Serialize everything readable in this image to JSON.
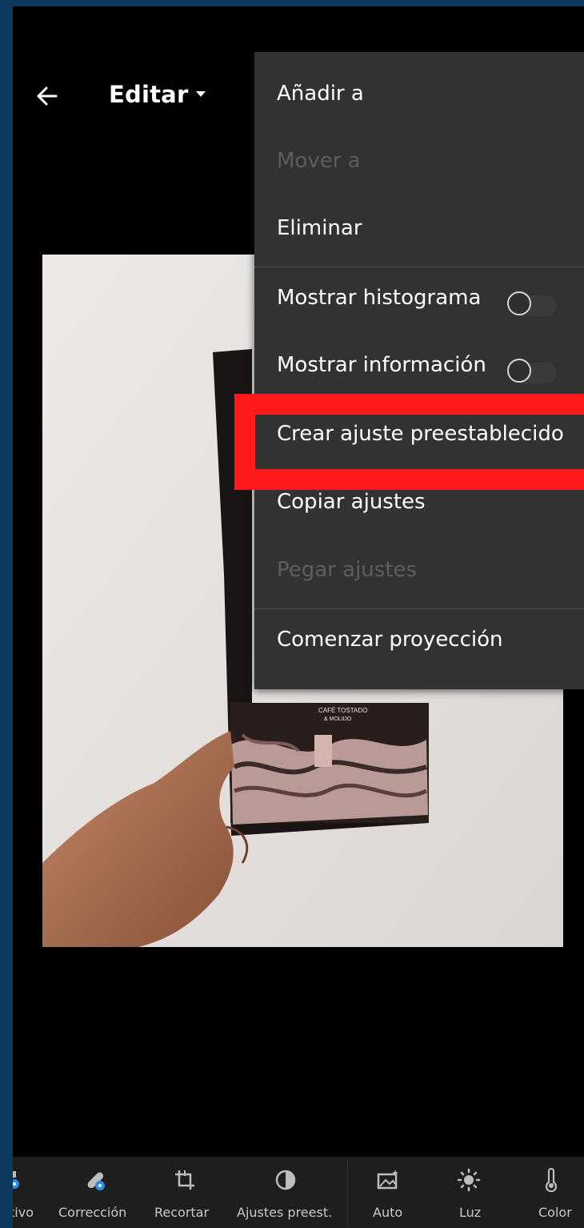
{
  "header": {
    "title": "Editar"
  },
  "menu": {
    "items": [
      {
        "label": "Añadir a",
        "enabled": true
      },
      {
        "label": "Mover a",
        "enabled": false
      },
      {
        "label": "Eliminar",
        "enabled": true
      },
      {
        "label": "Mostrar histograma",
        "enabled": true,
        "toggle": false
      },
      {
        "label": "Mostrar información",
        "enabled": true,
        "toggle": false
      },
      {
        "label": "Crear ajuste preestablecido",
        "enabled": true,
        "highlighted": true
      },
      {
        "label": "Copiar ajustes",
        "enabled": true
      },
      {
        "label": "Pegar ajustes",
        "enabled": false
      },
      {
        "label": "Comenzar proyección",
        "enabled": true
      }
    ]
  },
  "photo": {
    "package_text": [
      "CAFÉ TOSTADO",
      "& MOLIDO"
    ]
  },
  "toolbar": {
    "tools": [
      {
        "label": "tivo",
        "icon": "selective-icon"
      },
      {
        "label": "Corrección",
        "icon": "bandage-icon"
      },
      {
        "label": "Recortar",
        "icon": "crop-icon"
      },
      {
        "label": "Ajustes preest.",
        "icon": "presets-icon"
      },
      {
        "label": "Auto",
        "icon": "auto-icon"
      },
      {
        "label": "Luz",
        "icon": "sun-icon"
      },
      {
        "label": "Color",
        "icon": "thermometer-icon"
      }
    ]
  },
  "colors": {
    "frame": "#0b3a5e",
    "menu_bg": "#323232",
    "highlight": "#ff1b1b",
    "disabled_text": "#5d5d5d",
    "toolbar_bg": "#1e1e1e"
  }
}
